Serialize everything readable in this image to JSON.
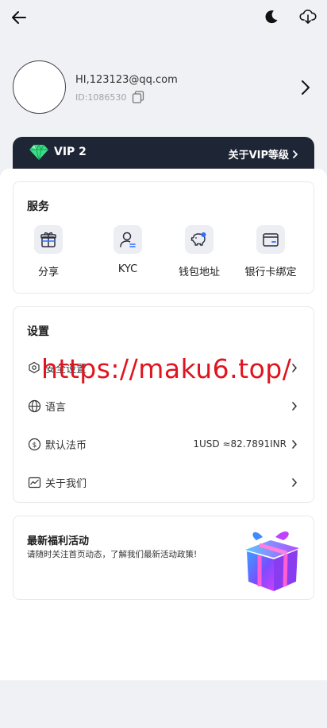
{
  "header": {
    "back_icon": "arrow-left-icon",
    "theme_icon": "moon-icon",
    "download_icon": "cloud-download-icon"
  },
  "profile": {
    "email": "HI,123123@qq.com",
    "user_id": "ID:1086530"
  },
  "vip": {
    "level_label": "VIP 2",
    "link_label": "关于VIP等级",
    "banner_color": "#1e2635",
    "gem_color": "#3ddc84"
  },
  "services": {
    "title": "服务",
    "items": [
      {
        "label": "分享",
        "icon": "gift-icon"
      },
      {
        "label": "KYC",
        "icon": "user-verify-icon"
      },
      {
        "label": "钱包地址",
        "icon": "piggy-bank-icon"
      },
      {
        "label": "银行卡绑定",
        "icon": "wallet-card-icon"
      }
    ]
  },
  "settings": {
    "title": "设置",
    "items": [
      {
        "label": "安全设置",
        "icon": "shield-icon",
        "value": ""
      },
      {
        "label": "语言",
        "icon": "globe-icon",
        "value": ""
      },
      {
        "label": "默认法币",
        "icon": "dollar-icon",
        "value": "1USD ≈82.7891INR"
      },
      {
        "label": "关于我们",
        "icon": "chart-icon",
        "value": ""
      }
    ]
  },
  "watermark": {
    "text": "https://maku6.top/",
    "color": "#e0141e"
  },
  "promo": {
    "title": "最新福利活动",
    "description": "请随时关注首页动态，了解我们最新活动政策!"
  }
}
